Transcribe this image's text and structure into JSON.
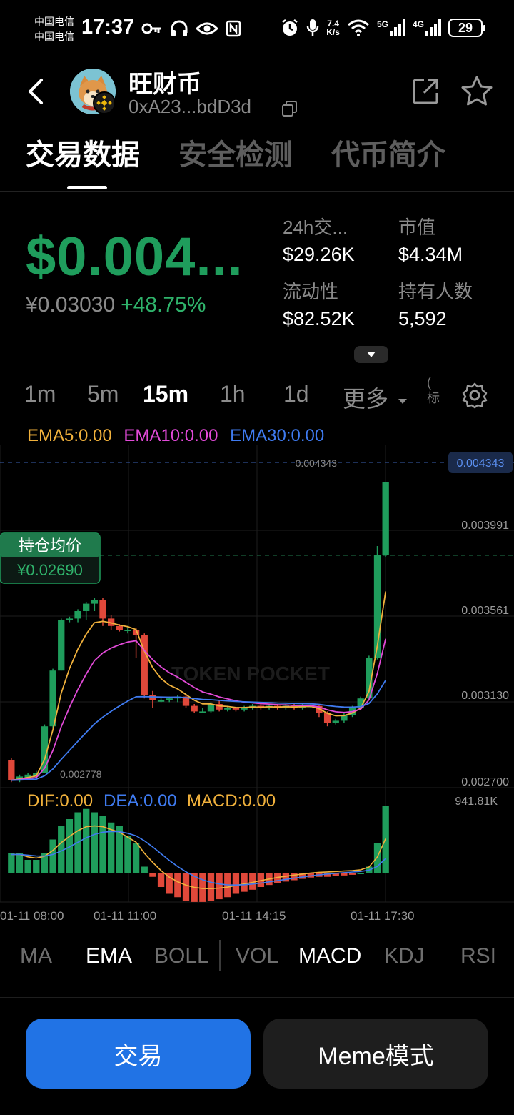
{
  "status_bar": {
    "carrier1": "中国电信",
    "carrier2": "中国电信",
    "time": "17:37",
    "net_speed_value": "7.4",
    "net_speed_unit": "K/s",
    "signal1": "5G",
    "signal2": "4G",
    "battery": "29"
  },
  "header": {
    "token_name": "旺财币",
    "address": "0xA23...bdD3d"
  },
  "tabs": [
    "交易数据",
    "安全检测",
    "代币简介"
  ],
  "price": {
    "usd": "$0.004...",
    "cny": "¥0.03030",
    "change": "+48.75%"
  },
  "stats": {
    "volume_label": "24h交...",
    "volume_value": "$29.26K",
    "mcap_label": "市值",
    "mcap_value": "$4.34M",
    "liquidity_label": "流动性",
    "liquidity_value": "$82.52K",
    "holders_label": "持有人数",
    "holders_value": "5,592"
  },
  "timeframes": [
    "1m",
    "5m",
    "15m",
    "1h",
    "1d"
  ],
  "timeframe_active": "15m",
  "more_label": "更多",
  "divider_text": "(\n标",
  "ema_legend": {
    "ema5": "EMA5:0.00",
    "ema10": "EMA10:0.00",
    "ema30": "EMA30:0.00"
  },
  "macd_legend": {
    "dif": "DIF:0.00",
    "dea": "DEA:0.00",
    "macd": "MACD:0.00"
  },
  "colors": {
    "up": "#1f9d5c",
    "down": "#e0483a",
    "ema5": "#f0b13c",
    "ema10": "#e24ad8",
    "ema30": "#3f7bf0",
    "accent": "#2173e5"
  },
  "chart_data": {
    "type": "candlestick",
    "y_axis_labels": [
      "0.003991",
      "0.003561",
      "0.003130",
      "0.002700"
    ],
    "current_price_label": "0.004343",
    "high_marker": "0.004343",
    "low_marker": "0.002778",
    "volume_max_label": "941.81K",
    "x_axis_labels": [
      "01-11 08:00",
      "01-11 11:00",
      "01-11 14:15",
      "01-11 17:30"
    ],
    "ylim": [
      0.0027,
      0.00445
    ],
    "position_label": "持仓均价",
    "position_value": "¥0.02690",
    "position_price": 0.00395,
    "watermark": "TOKEN POCKET",
    "candles": [
      {
        "o": 0.00285,
        "c": 0.00274,
        "h": 0.00286,
        "l": 0.00273
      },
      {
        "o": 0.00274,
        "c": 0.00276,
        "h": 0.00277,
        "l": 0.00273
      },
      {
        "o": 0.00275,
        "c": 0.00277,
        "h": 0.00278,
        "l": 0.00274
      },
      {
        "o": 0.00276,
        "c": 0.00278,
        "h": 0.00279,
        "l": 0.00275
      },
      {
        "o": 0.00278,
        "c": 0.00303,
        "h": 0.00304,
        "l": 0.00278
      },
      {
        "o": 0.00303,
        "c": 0.00333,
        "h": 0.00334,
        "l": 0.00302
      },
      {
        "o": 0.00333,
        "c": 0.0036,
        "h": 0.00361,
        "l": 0.00333
      },
      {
        "o": 0.0036,
        "c": 0.00361,
        "h": 0.00362,
        "l": 0.00359
      },
      {
        "o": 0.00361,
        "c": 0.00365,
        "h": 0.00366,
        "l": 0.00359
      },
      {
        "o": 0.00365,
        "c": 0.00369,
        "h": 0.0037,
        "l": 0.0036
      },
      {
        "o": 0.00369,
        "c": 0.00371,
        "h": 0.00372,
        "l": 0.00365
      },
      {
        "o": 0.00371,
        "c": 0.00361,
        "h": 0.00372,
        "l": 0.00357
      },
      {
        "o": 0.00361,
        "c": 0.00357,
        "h": 0.00363,
        "l": 0.00355
      },
      {
        "o": 0.00357,
        "c": 0.00355,
        "h": 0.00358,
        "l": 0.00354
      },
      {
        "o": 0.00355,
        "c": 0.00355,
        "h": 0.00357,
        "l": 0.00353
      },
      {
        "o": 0.00355,
        "c": 0.00352,
        "h": 0.00356,
        "l": 0.0034
      },
      {
        "o": 0.00352,
        "c": 0.0032,
        "h": 0.00353,
        "l": 0.00318
      },
      {
        "o": 0.0032,
        "c": 0.00317,
        "h": 0.00322,
        "l": 0.00313
      },
      {
        "o": 0.00317,
        "c": 0.00317,
        "h": 0.00318,
        "l": 0.00316
      },
      {
        "o": 0.00317,
        "c": 0.00318,
        "h": 0.00319,
        "l": 0.00316
      },
      {
        "o": 0.00318,
        "c": 0.00319,
        "h": 0.0032,
        "l": 0.00316
      },
      {
        "o": 0.00319,
        "c": 0.00314,
        "h": 0.0032,
        "l": 0.00313
      },
      {
        "o": 0.00314,
        "c": 0.00311,
        "h": 0.00315,
        "l": 0.0031
      },
      {
        "o": 0.00311,
        "c": 0.00311,
        "h": 0.00313,
        "l": 0.0031
      },
      {
        "o": 0.00311,
        "c": 0.00315,
        "h": 0.00316,
        "l": 0.0031
      },
      {
        "o": 0.00315,
        "c": 0.00312,
        "h": 0.00317,
        "l": 0.00311
      },
      {
        "o": 0.00312,
        "c": 0.00313,
        "h": 0.00314,
        "l": 0.00311
      },
      {
        "o": 0.00313,
        "c": 0.00312,
        "h": 0.00313,
        "l": 0.00311
      },
      {
        "o": 0.00312,
        "c": 0.00313,
        "h": 0.00314,
        "l": 0.00311
      },
      {
        "o": 0.00313,
        "c": 0.00314,
        "h": 0.00315,
        "l": 0.00312
      },
      {
        "o": 0.00314,
        "c": 0.00313,
        "h": 0.00315,
        "l": 0.00312
      },
      {
        "o": 0.00313,
        "c": 0.00314,
        "h": 0.00315,
        "l": 0.00312
      },
      {
        "o": 0.00314,
        "c": 0.00313,
        "h": 0.00315,
        "l": 0.00312
      },
      {
        "o": 0.00313,
        "c": 0.00314,
        "h": 0.00315,
        "l": 0.00312
      },
      {
        "o": 0.00314,
        "c": 0.00313,
        "h": 0.00315,
        "l": 0.00312
      },
      {
        "o": 0.00313,
        "c": 0.00314,
        "h": 0.00315,
        "l": 0.00312
      },
      {
        "o": 0.00314,
        "c": 0.00314,
        "h": 0.00315,
        "l": 0.00313
      },
      {
        "o": 0.00314,
        "c": 0.0031,
        "h": 0.00315,
        "l": 0.00308
      },
      {
        "o": 0.0031,
        "c": 0.00305,
        "h": 0.00311,
        "l": 0.00303
      },
      {
        "o": 0.00305,
        "c": 0.00306,
        "h": 0.00307,
        "l": 0.00304
      },
      {
        "o": 0.00306,
        "c": 0.00309,
        "h": 0.0031,
        "l": 0.00305
      },
      {
        "o": 0.00309,
        "c": 0.00313,
        "h": 0.00314,
        "l": 0.00308
      },
      {
        "o": 0.00313,
        "c": 0.00318,
        "h": 0.00319,
        "l": 0.00312
      },
      {
        "o": 0.00318,
        "c": 0.0034,
        "h": 0.00341,
        "l": 0.00317
      },
      {
        "o": 0.0034,
        "c": 0.00395,
        "h": 0.004,
        "l": 0.00339
      },
      {
        "o": 0.00395,
        "c": 0.004343,
        "h": 0.004343,
        "l": 0.00394
      }
    ],
    "macd_hist": [
      0.3,
      0.3,
      0.2,
      0.2,
      0.3,
      0.5,
      0.7,
      0.8,
      0.9,
      0.95,
      0.9,
      0.85,
      0.75,
      0.7,
      0.55,
      0.45,
      0.1,
      -0.05,
      -0.2,
      -0.3,
      -0.35,
      -0.4,
      -0.42,
      -0.42,
      -0.4,
      -0.38,
      -0.35,
      -0.3,
      -0.27,
      -0.24,
      -0.2,
      -0.17,
      -0.14,
      -0.12,
      -0.1,
      -0.08,
      -0.06,
      -0.05,
      -0.05,
      -0.04,
      -0.03,
      -0.02,
      0.0,
      0.1,
      0.45,
      1.0
    ]
  },
  "indicators": [
    "MA",
    "EMA",
    "BOLL",
    "VOL",
    "MACD",
    "KDJ",
    "RSI"
  ],
  "indicators_active": [
    "EMA",
    "MACD"
  ],
  "buttons": {
    "trade": "交易",
    "meme": "Meme模式"
  }
}
